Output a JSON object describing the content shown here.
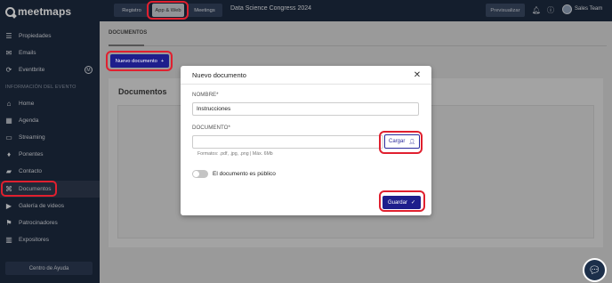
{
  "app": {
    "brand": "meetmaps"
  },
  "sidebar": {
    "items_top": [
      {
        "label": "Propiedades",
        "icon": "list-icon",
        "glyph": "☰"
      },
      {
        "label": "Emails",
        "icon": "mail-icon",
        "glyph": "✉"
      },
      {
        "label": "Eventbrite",
        "icon": "sync-icon",
        "glyph": "⟳",
        "badge": "M"
      }
    ],
    "section_label": "INFORMACIÓN DEL EVENTO",
    "items_event": [
      {
        "label": "Home",
        "icon": "home-icon",
        "glyph": "⌂"
      },
      {
        "label": "Agenda",
        "icon": "calendar-icon",
        "glyph": "▦"
      },
      {
        "label": "Streaming",
        "icon": "video-icon",
        "glyph": "▭"
      },
      {
        "label": "Ponentes",
        "icon": "microphone-icon",
        "glyph": "♦"
      },
      {
        "label": "Contacto",
        "icon": "chat-icon",
        "glyph": "▰"
      },
      {
        "label": "Documentos",
        "icon": "paperclip-icon",
        "glyph": "⌘"
      },
      {
        "label": "Galería de videos",
        "icon": "camera-icon",
        "glyph": "▶"
      },
      {
        "label": "Patrocinadores",
        "icon": "flag-icon",
        "glyph": "⚑"
      },
      {
        "label": "Expositores",
        "icon": "store-icon",
        "glyph": "▥"
      }
    ],
    "help_label": "Centro de Ayuda"
  },
  "topbar": {
    "tabs": {
      "registro": "Registro",
      "app": "App & Web",
      "meetings": "Meetings"
    },
    "event_title": "Data Science Congress 2024",
    "preview_label": "Previsualizar",
    "user_name": "Sales Team"
  },
  "main": {
    "tab_label": "DOCUMENTOS",
    "new_doc_label": "Nuevo documento",
    "card_title": "Documentos"
  },
  "modal": {
    "title": "Nuevo documento",
    "name_label": "NOMBRE*",
    "name_value": "Instrucciones",
    "doc_label": "DOCUMENTO*",
    "upload_label": "Cargar",
    "hint": "Formatos: .pdf, .jpg, .png | Máx. 6Mb",
    "public_label": "El documento es público",
    "save_label": "Guardar"
  }
}
